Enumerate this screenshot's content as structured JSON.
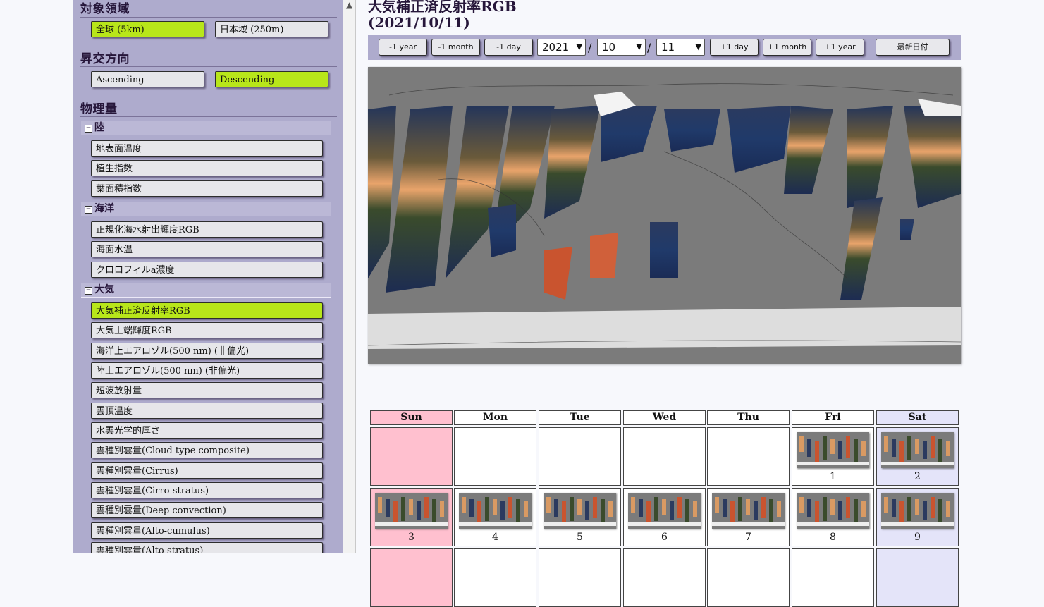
{
  "sidebar": {
    "region": {
      "title": "対象領域",
      "options": [
        {
          "label": "全球 (5km)",
          "selected": true
        },
        {
          "label": "日本域 (250m)",
          "selected": false
        }
      ]
    },
    "direction": {
      "title": "昇交方向",
      "options": [
        {
          "label": "Ascending",
          "selected": false
        },
        {
          "label": "Descending",
          "selected": true
        }
      ]
    },
    "physics": {
      "title": "物理量",
      "categories": [
        {
          "label": "陸",
          "toggle": "⊟",
          "items": [
            "地表面温度",
            "植生指数",
            "葉面積指数"
          ]
        },
        {
          "label": "海洋",
          "toggle": "⊟",
          "items": [
            "正規化海水射出輝度RGB",
            "海面水温",
            "クロロフィルa濃度"
          ]
        },
        {
          "label": "大気",
          "toggle": "⊟",
          "items": [
            "大気補正済反射率RGB",
            "大気上端輝度RGB",
            "海洋上エアロゾル(500 nm) (非偏光)",
            "陸上エアロゾル(500 nm) (非偏光)",
            "短波放射量",
            "雲頂温度",
            "水雲光学的厚さ",
            "雲種別雲量(Cloud type composite)",
            "雲種別雲量(Cirrus)",
            "雲種別雲量(Cirro-stratus)",
            "雲種別雲量(Deep convection)",
            "雲種別雲量(Alto-cumulus)",
            "雲種別雲量(Alto-stratus)"
          ]
        }
      ],
      "selected_item": "大気補正済反射率RGB"
    }
  },
  "main": {
    "title_line1": "大気補正済反射率RGB",
    "title_line2": "(2021/10/11)",
    "toolbar": {
      "minus_year": "-1 year",
      "minus_month": "-1 month",
      "minus_day": "-1 day",
      "year": "2021",
      "month": "10",
      "day": "11",
      "sep": "/",
      "plus_day": "+1 day",
      "plus_month": "+1 month",
      "plus_year": "+1 year",
      "latest": "最新日付"
    }
  },
  "calendar": {
    "weekdays": [
      "Sun",
      "Mon",
      "Tue",
      "Wed",
      "Thu",
      "Fri",
      "Sat"
    ],
    "weeks": [
      [
        "",
        "",
        "",
        "",
        "",
        "1",
        "2"
      ],
      [
        "3",
        "4",
        "5",
        "6",
        "7",
        "8",
        "9"
      ]
    ]
  },
  "colors": {
    "sidebar_bg": "#aeabcd",
    "selected_green": "#b8e61a",
    "sunday_pink": "#ffc0cf",
    "saturday_lavender": "#e4e4f9",
    "map_no_data_gray": "#7b7b7b"
  }
}
